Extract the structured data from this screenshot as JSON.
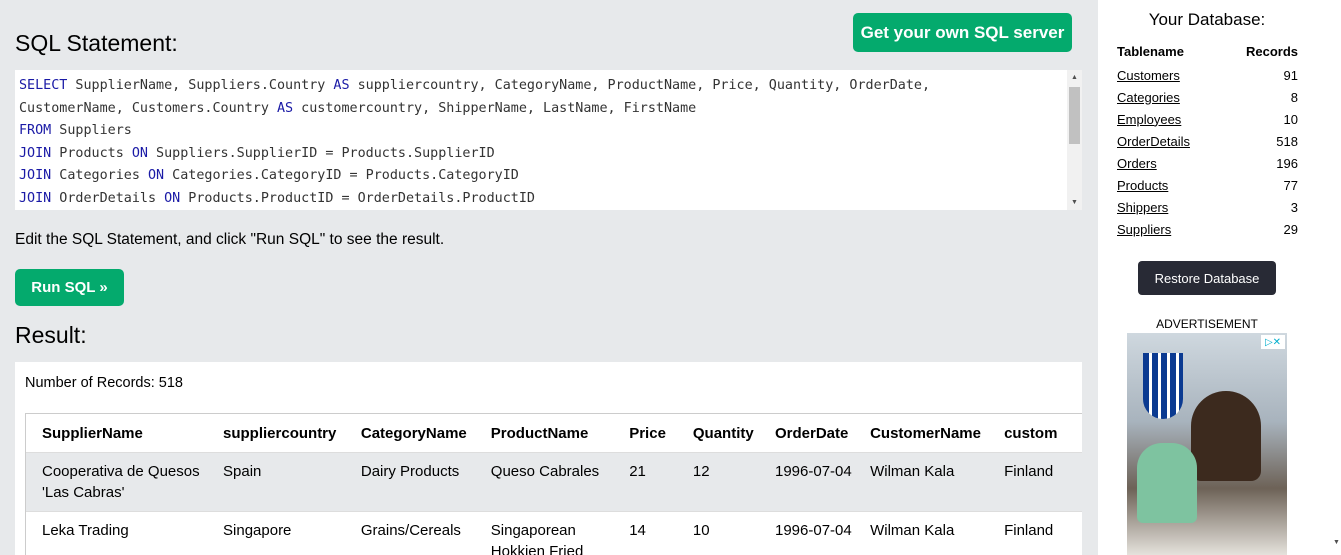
{
  "editor": {
    "title": "SQL Statement:",
    "own_server_button": "Get your own SQL server",
    "lines": [
      [
        {
          "t": "SELECT",
          "k": true
        },
        {
          "t": " SupplierName, Suppliers.Country "
        },
        {
          "t": "AS",
          "k": true
        },
        {
          "t": " suppliercountry, CategoryName, ProductName, Price, Quantity, OrderDate,"
        }
      ],
      [
        {
          "t": "CustomerName, Customers.Country "
        },
        {
          "t": "AS",
          "k": true
        },
        {
          "t": " customercountry, ShipperName, LastName, FirstName"
        }
      ],
      [
        {
          "t": "FROM",
          "k": true
        },
        {
          "t": " Suppliers"
        }
      ],
      [
        {
          "t": "JOIN",
          "k": true
        },
        {
          "t": " Products "
        },
        {
          "t": "ON",
          "k": true
        },
        {
          "t": " Suppliers.SupplierID = Products.SupplierID"
        }
      ],
      [
        {
          "t": "JOIN",
          "k": true
        },
        {
          "t": " Categories "
        },
        {
          "t": "ON",
          "k": true
        },
        {
          "t": " Categories.CategoryID = Products.CategoryID"
        }
      ],
      [
        {
          "t": "JOIN",
          "k": true
        },
        {
          "t": " OrderDetails "
        },
        {
          "t": "ON",
          "k": true
        },
        {
          "t": " Products.ProductID = OrderDetails.ProductID"
        }
      ]
    ],
    "hint": "Edit the SQL Statement, and click \"Run SQL\" to see the result.",
    "run_button": "Run SQL »"
  },
  "result": {
    "title": "Result:",
    "record_count": "Number of Records: 518",
    "columns": [
      "SupplierName",
      "suppliercountry",
      "CategoryName",
      "ProductName",
      "Price",
      "Quantity",
      "OrderDate",
      "CustomerName",
      "custom"
    ],
    "rows": [
      [
        "Cooperativa de Quesos 'Las Cabras'",
        "Spain",
        "Dairy Products",
        "Queso Cabrales",
        "21",
        "12",
        "1996-07-04",
        "Wilman Kala",
        "Finland"
      ],
      [
        "Leka Trading",
        "Singapore",
        "Grains/Cereals",
        "Singaporean Hokkien Fried",
        "14",
        "10",
        "1996-07-04",
        "Wilman Kala",
        "Finland"
      ]
    ]
  },
  "sidebar": {
    "title": "Your Database:",
    "header_tablename": "Tablename",
    "header_records": "Records",
    "tables": [
      {
        "name": "Customers",
        "records": "91"
      },
      {
        "name": "Categories",
        "records": "8"
      },
      {
        "name": "Employees",
        "records": "10"
      },
      {
        "name": "OrderDetails",
        "records": "518"
      },
      {
        "name": "Orders",
        "records": "196"
      },
      {
        "name": "Products",
        "records": "77"
      },
      {
        "name": "Shippers",
        "records": "3"
      },
      {
        "name": "Suppliers",
        "records": "29"
      }
    ],
    "restore_button": "Restore Database",
    "ad_label": "ADVERTISEMENT",
    "ad_close": "▷✕"
  },
  "icons": {
    "scroll_up": "▲",
    "scroll_down": "▼"
  },
  "colors": {
    "green": "#04aa6d",
    "dark": "#282a35",
    "keyword": "#1a1aa6"
  }
}
